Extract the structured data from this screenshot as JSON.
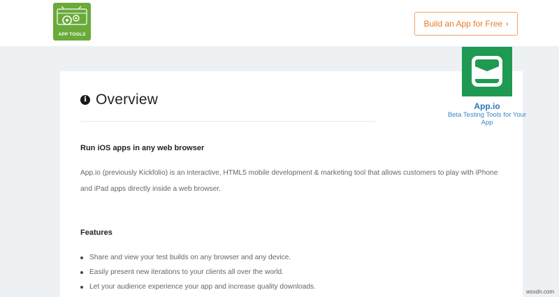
{
  "header": {
    "logo_text": "APP TOOLS",
    "cta_label": "Build an App for Free",
    "cta_chevron": "›"
  },
  "overview": {
    "info_glyph": "i",
    "title": "Overview",
    "subheading": "Run iOS apps in any web browser",
    "paragraph": "App.io (previously Kickfolio) is an interactive, HTML5 mobile development & marketing tool that allows customers to play with iPhone and iPad apps directly inside a web browser."
  },
  "features": {
    "heading": "Features",
    "items": [
      "Share and view your test builds on any browser and any device.",
      "Easily present new iterations to your clients all over the world.",
      "Let your audience experience your app and increase quality downloads."
    ]
  },
  "app_badge": {
    "name": "App.io",
    "tagline": "Beta Testing Tools for Your App",
    "color": "#1e9a52"
  },
  "watermark": "wsxdn.com",
  "colors": {
    "accent": "#e8782a",
    "page_bg": "#eef1f4",
    "logo_bg": "#6aaa3a",
    "link_blue": "#2a76b8"
  }
}
